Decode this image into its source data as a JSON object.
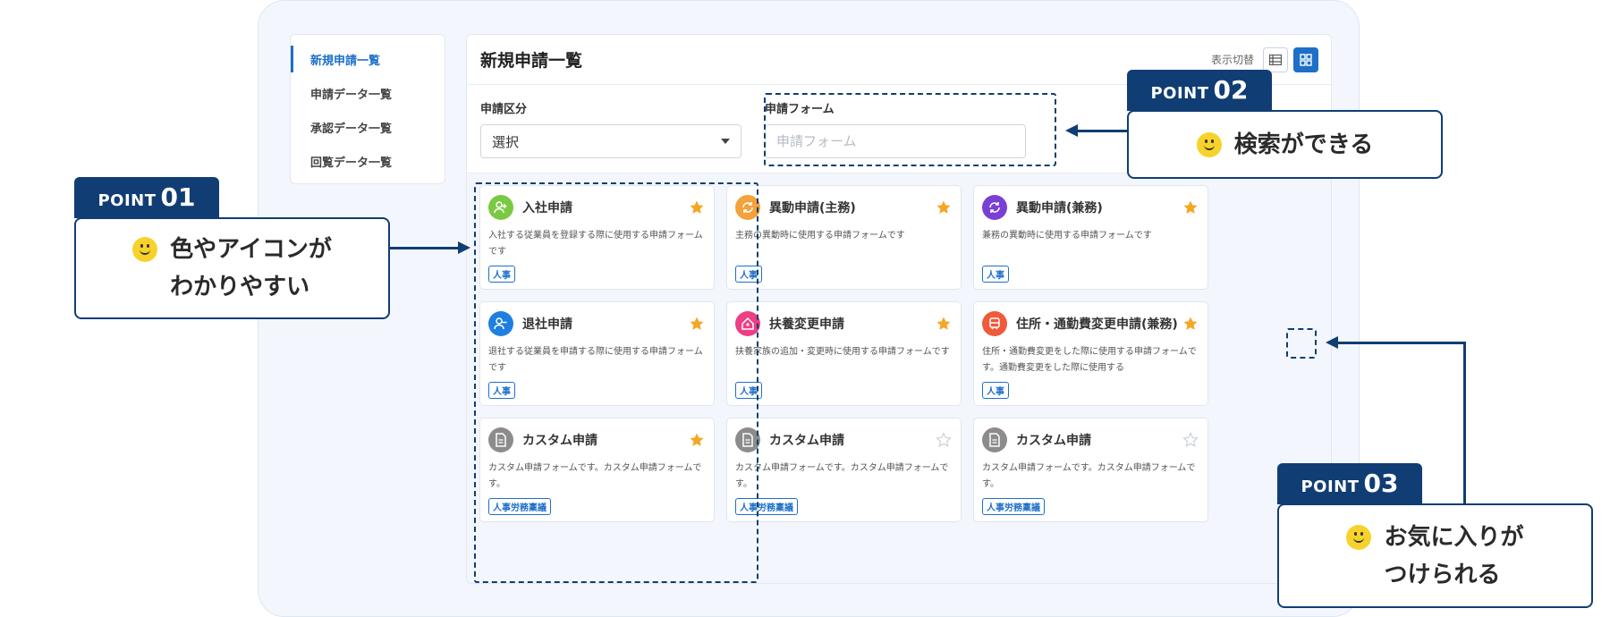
{
  "sidebar": {
    "items": [
      {
        "label": "新規申請一覧",
        "active": true
      },
      {
        "label": "申請データ一覧",
        "active": false
      },
      {
        "label": "承認データ一覧",
        "active": false
      },
      {
        "label": "回覧データ一覧",
        "active": false
      }
    ]
  },
  "main": {
    "title": "新規申請一覧",
    "view_toggle_label": "表示切替",
    "filters": {
      "category_label": "申請区分",
      "category_value": "選択",
      "form_label": "申請フォーム",
      "form_placeholder": "申請フォーム"
    },
    "cards": [
      {
        "title": "入社申請",
        "desc": "入社する従業員を登録する際に使用する申請フォームです",
        "tag": "人事",
        "icon": "user-add-icon",
        "color": "#7ac943",
        "favorite": true
      },
      {
        "title": "異動申請(主務)",
        "desc": "主務の異動時に使用する申請フォームです",
        "tag": "人事",
        "icon": "refresh-icon",
        "color": "#f4a23b",
        "favorite": true
      },
      {
        "title": "異動申請(兼務)",
        "desc": "兼務の異動時に使用する申請フォームです",
        "tag": "人事",
        "icon": "refresh-icon",
        "color": "#7a3fd6",
        "favorite": true
      },
      {
        "title": "退社申請",
        "desc": "退社する従業員を申請する際に使用する申請フォームです",
        "tag": "人事",
        "icon": "user-remove-icon",
        "color": "#1e7fe0",
        "favorite": true
      },
      {
        "title": "扶養変更申請",
        "desc": "扶養家族の追加・変更時に使用する申請フォームです",
        "tag": "人事",
        "icon": "home-user-icon",
        "color": "#ec3f86",
        "favorite": true
      },
      {
        "title": "住所・通勤費変更申請(兼務)",
        "desc": "住所・通勤費変更をした際に使用する申請フォームです。通勤費変更をした際に使用する",
        "tag": "人事",
        "icon": "train-icon",
        "color": "#ef5a3a",
        "favorite": true
      },
      {
        "title": "カスタム申請",
        "desc": "カスタム申請フォームです。カスタム申請フォームです。",
        "tag": "人事労務稟議",
        "icon": "document-icon",
        "color": "#8c8c8c",
        "favorite": true
      },
      {
        "title": "カスタム申請",
        "desc": "カスタム申請フォームです。カスタム申請フォームです。",
        "tag": "人事労務稟議",
        "icon": "document-icon",
        "color": "#8c8c8c",
        "favorite": false
      },
      {
        "title": "カスタム申請",
        "desc": "カスタム申請フォームです。カスタム申請フォームです。",
        "tag": "人事労務稟議",
        "icon": "document-icon",
        "color": "#8c8c8c",
        "favorite": false
      }
    ]
  },
  "callouts": {
    "point01": {
      "word": "POINT",
      "num": "01",
      "line1": "色やアイコンが",
      "line2": "わかりやすい"
    },
    "point02": {
      "word": "POINT",
      "num": "02",
      "line1": "検索ができる"
    },
    "point03": {
      "word": "POINT",
      "num": "03",
      "line1": "お気に入りが",
      "line2": "つけられる"
    }
  },
  "colors": {
    "accent": "#1e6fc8",
    "navy": "#103d73",
    "star": "#f5a623",
    "smile": "#f7d22b"
  }
}
